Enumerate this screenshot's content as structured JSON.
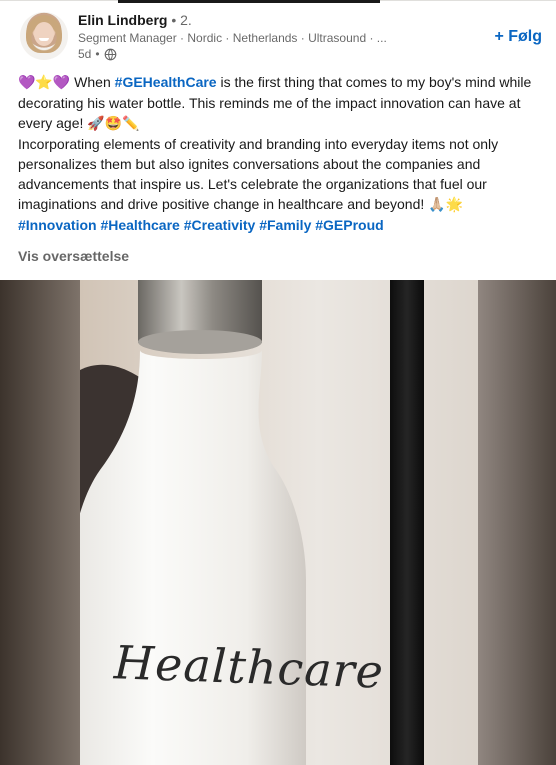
{
  "author": {
    "name": "Elin Lindberg",
    "degree": "• 2.",
    "headline": "Segment Manager · Nordic · Netherlands · Ultrasound · ...",
    "time": "5d",
    "dot": "•"
  },
  "follow_label": "+ Følg",
  "post": {
    "line1_emojis": "💜⭐💜",
    "line1_before": " When ",
    "tag_gehc": "#GEHealthCare",
    "line1_after": " is the first thing that comes to my boy's mind while decorating his water bottle. This reminds me of the impact innovation can have at every age! ",
    "line1_end_emojis": "🚀🤩✏️",
    "paragraph2": "Incorporating elements of creativity and branding into everyday items not only personalizes them but also ignites conversations about the companies and advancements that inspire us. Let's celebrate the organizations that fuel our imaginations and drive positive change in healthcare and beyond! ",
    "paragraph2_emojis": "🙏🏼🌟",
    "hashtags": [
      "#Innovation",
      "#Healthcare",
      "#Creativity",
      "#Family",
      "#GEProud"
    ]
  },
  "translate_label": "Vis oversættelse",
  "image": {
    "bottle_text": "Healthcare"
  },
  "colors": {
    "link": "#0a66c2",
    "text": "#191919",
    "muted": "#666666"
  }
}
